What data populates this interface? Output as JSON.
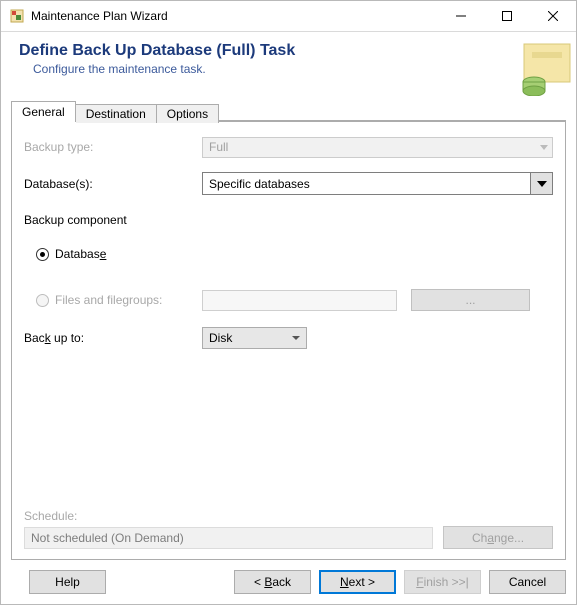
{
  "window": {
    "title": "Maintenance Plan Wizard"
  },
  "header": {
    "title": "Define Back Up Database (Full) Task",
    "subtitle": "Configure the maintenance task."
  },
  "tabs": {
    "general": "General",
    "destination": "Destination",
    "options": "Options"
  },
  "general": {
    "backup_type_label": "Backup type:",
    "backup_type_value": "Full",
    "databases_label": "Database(s):",
    "databases_value": "Specific databases",
    "backup_component_label": "Backup component",
    "radio_database": "Database",
    "radio_filegroups": "Files and filegroups:",
    "ellipsis": "...",
    "back_up_to_label": "Back up to:",
    "back_up_to_value": "Disk"
  },
  "schedule": {
    "label": "Schedule:",
    "value": "Not scheduled (On Demand)",
    "change": "Change..."
  },
  "footer": {
    "help": "Help",
    "back": "< Back",
    "next": "Next >",
    "finish": "Finish >>|",
    "cancel": "Cancel"
  }
}
